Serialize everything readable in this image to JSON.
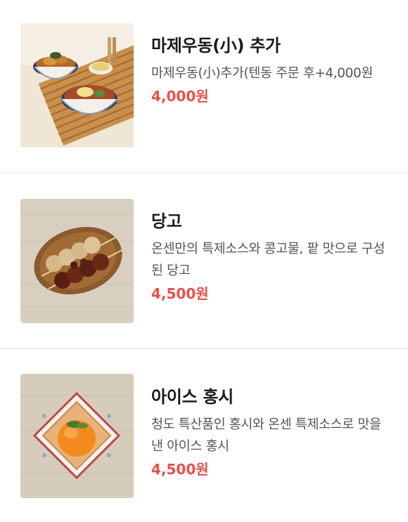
{
  "colors": {
    "price": "#e8504b",
    "name": "#1a1a1a",
    "desc": "#555555",
    "divider": "#f0f0f0"
  },
  "menu": {
    "items": [
      {
        "name": "마제우동(小) 추가",
        "description": "마제우동(小)추가(텐동 주문 후+4,000원",
        "price": "4,000원",
        "image_icon": "udon-tendon-set-image"
      },
      {
        "name": "당고",
        "description": "온센만의 특제소스와 콩고물, 팥 맛으로 구성 된 당고",
        "price": "4,500원",
        "image_icon": "dango-skewers-image"
      },
      {
        "name": "아이스 홍시",
        "description": "청도 특산품인 홍시와 온센 특제소스로 맛을 낸 아이스 홍시",
        "price": "4,500원",
        "image_icon": "ice-persimmon-image"
      }
    ]
  }
}
